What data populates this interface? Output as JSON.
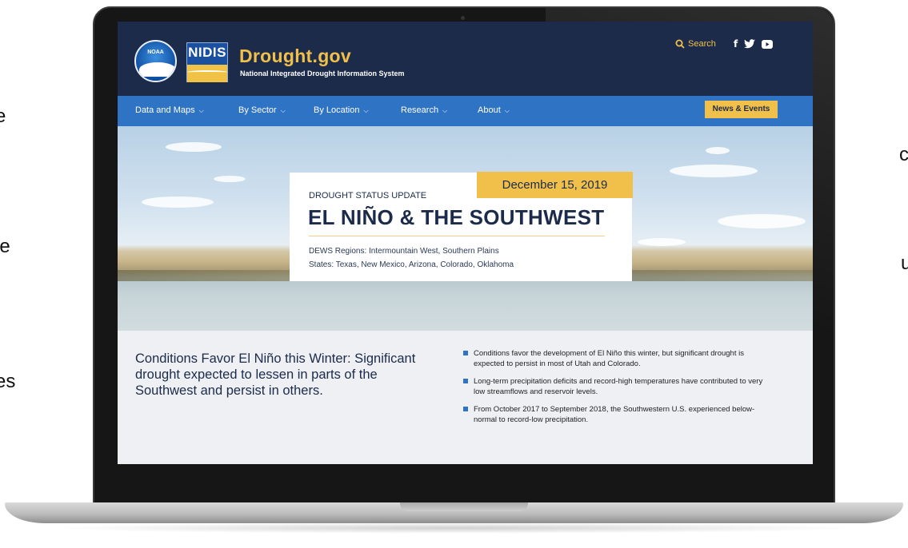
{
  "slide_edges": {
    "left": [
      "e",
      "le",
      "es"
    ],
    "right": [
      "c",
      "u"
    ]
  },
  "site": {
    "logo_noaa": "NOAA",
    "logo_nidis": "NIDIS",
    "title": "Drought.gov",
    "subtitle": "National Integrated Drought Information System",
    "search_label": "Search",
    "social": [
      "f",
      "twitter-icon",
      "youtube-icon"
    ]
  },
  "nav": {
    "items": [
      "Data and Maps",
      "By Sector",
      "By Location",
      "Research",
      "About"
    ],
    "news_button": "News & Events"
  },
  "hero": {
    "date": "December 15, 2019",
    "kicker": "DROUGHT STATUS UPDATE",
    "title": "EL NIÑO & THE SOUTHWEST",
    "regions": "DEWS Regions: Intermountain West, Southern Plains",
    "states": "States: Texas, New Mexico, Arizona, Colorado, Oklahoma"
  },
  "summary": {
    "lead": "Conditions Favor El Niño this Winter: Significant drought expected to lessen in parts of the Southwest and persist in others.",
    "bullets": [
      "Conditions favor the development of El Niño this winter, but significant drought is expected to persist in most of Utah and Colorado.",
      "Long-term precipitation deficits and record-high temperatures have contributed to very low streamflows and reservoir levels.",
      "From October 2017 to September 2018, the Southwestern U.S. experienced below-normal to record-low precipitation."
    ]
  },
  "colors": {
    "navy": "#1c2b4a",
    "nav_blue": "#2f73c4",
    "gold": "#f1c04a"
  }
}
